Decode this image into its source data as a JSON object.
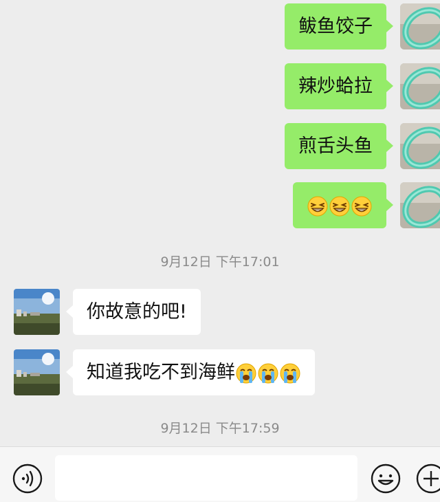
{
  "chat": {
    "outgoing": [
      {
        "text": "鲅鱼饺子"
      },
      {
        "text": "辣炒蛤拉"
      },
      {
        "text": "煎舌头鱼"
      },
      {
        "emoji": [
          "grinning-squint",
          "grinning-squint",
          "grinning-squint"
        ]
      }
    ],
    "timestamp_1": "9月12日 下午17:01",
    "incoming": [
      {
        "text": "你故意的吧!"
      },
      {
        "text": "知道我吃不到海鲜",
        "emoji": [
          "loudly-crying",
          "loudly-crying",
          "loudly-crying"
        ]
      }
    ],
    "timestamp_2": "9月12日 下午17:59"
  },
  "toolbar": {
    "input_value": "",
    "icons": [
      "voice-icon",
      "emoji-icon",
      "plus-icon"
    ]
  },
  "colors": {
    "background": "#ededed",
    "outgoing_bubble": "#95ec69",
    "incoming_bubble": "#ffffff",
    "timestamp_text": "#8a8a8a"
  }
}
